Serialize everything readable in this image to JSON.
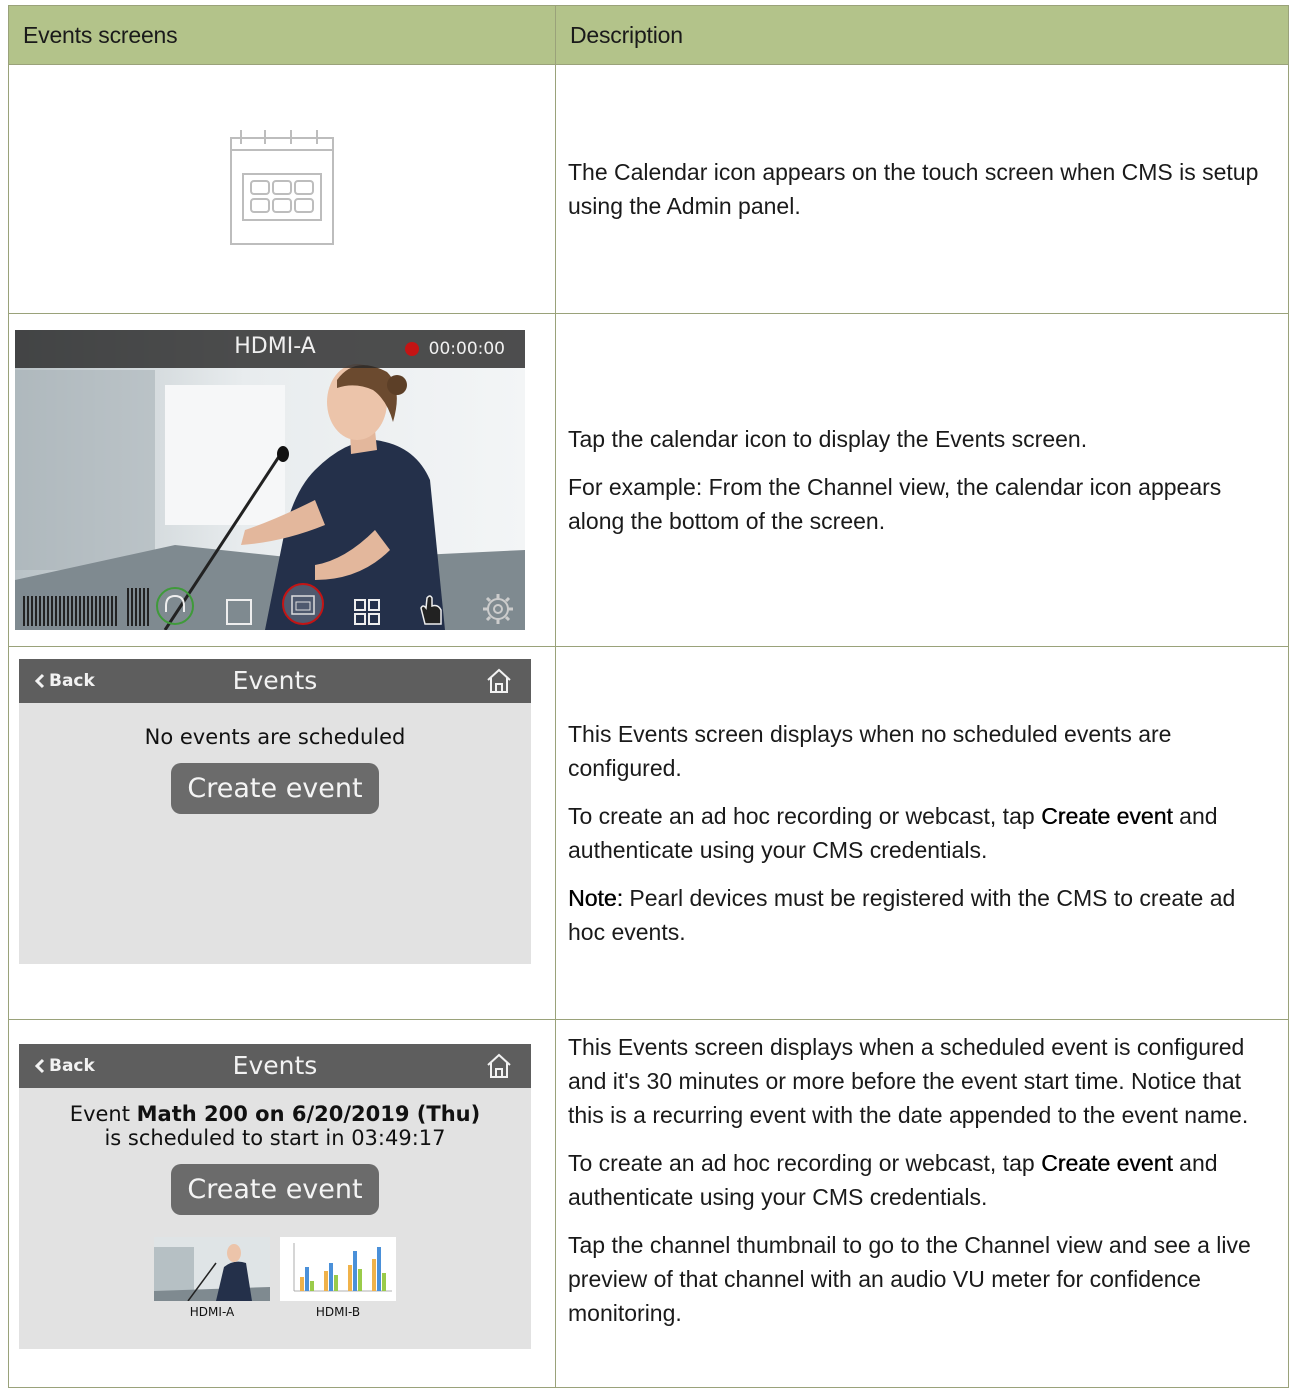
{
  "table": {
    "header": {
      "col1": "Events screens",
      "col2": "Description"
    },
    "rows": [
      {
        "paragraphs": [
          "The Calendar icon appears on the touch screen when CMS is setup using the Admin panel."
        ]
      },
      {
        "screen": {
          "input": "HDMI-A",
          "timer": "00:00:00"
        },
        "paragraphs": [
          "Tap the calendar icon to display the Events screen.",
          "For example: From the Channel view, the calendar icon appears along the bottom of the screen."
        ]
      },
      {
        "screen": {
          "back": "Back",
          "title": "Events",
          "message": "No events are scheduled",
          "create_button": "Create event"
        },
        "p1": "This Events screen displays when no scheduled events are configured.",
        "p2_pre": "To create an ad hoc recording or webcast, tap ",
        "p2_bold": "Create event",
        "p2_post": " and authenticate using your CMS credentials.",
        "p3_bold": "Note:",
        "p3_post": " Pearl devices must be registered with the CMS to create ad hoc events."
      },
      {
        "screen": {
          "back": "Back",
          "title": "Events",
          "msg_pre": "Event ",
          "msg_bold": "Math 200 on 6/20/2019 (Thu)",
          "msg_line2": "is scheduled to start in 03:49:17",
          "create_button": "Create event",
          "thumb_a": "HDMI-A",
          "thumb_b": "HDMI-B"
        },
        "p1": "This Events screen displays when a scheduled event is configured and it's 30 minutes or more before the event start time. Notice that this is a recurring event with the date appended to the event name.",
        "p2_pre": "To create an ad hoc recording or webcast, tap ",
        "p2_bold": "Create event",
        "p2_post": " and authenticate using your CMS credentials.",
        "p3": "Tap the channel thumbnail to go to the Channel view and see a live preview of that channel with an audio VU meter for confidence monitoring."
      }
    ]
  },
  "colors": {
    "header_bg": "#b3c38a",
    "border": "#9aa27a",
    "screen_header": "#5e5e5e",
    "screen_bg": "#e2e2e2",
    "button": "#6b6b6b",
    "record": "#c41414"
  },
  "icons": [
    "calendar-icon",
    "back-chevron-icon",
    "home-icon",
    "record-dot-icon",
    "headphones-icon",
    "stop-icon",
    "layout-grid-icon",
    "touch-hand-icon",
    "gear-icon"
  ]
}
